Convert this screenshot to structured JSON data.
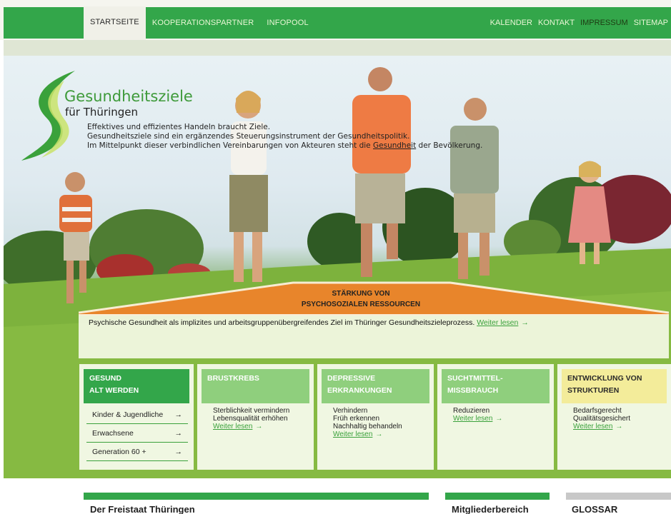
{
  "nav": {
    "left": [
      "STARTSEITE",
      "KOOPERATIONSPARTNER",
      "INFOPOOL"
    ],
    "right": [
      "KALENDER",
      "KONTAKT",
      "IMPRESSUM",
      "SITEMAP"
    ]
  },
  "logo": {
    "title": "Gesundheitsziele",
    "subtitle": "für Thüringen"
  },
  "intro": {
    "line1": "Effektives und effizientes Handeln braucht Ziele.",
    "line2": "Gesundheitsziele sind ein ergänzendes Steuerungsinstrument der Gesundheitspolitik.",
    "line3_a": "Im Mittelpunkt dieser verbindlichen Vereinbarungen von Akteuren steht die",
    "line3_link": "Gesundheit",
    "line3_b": "der Bevölkerung."
  },
  "feature": {
    "title_line1": "STÄRKUNG VON",
    "title_line2": "PSYCHOSOZIALEN RESSOURCEN",
    "text": "Psychische Gesundheit als implizites und arbeitsgruppenübergreifendes Ziel im Thüringer Gesundheitszieleprozess.",
    "more": "Weiter lesen"
  },
  "cards": {
    "c1": {
      "head1": "GESUND",
      "head2": "ALT WERDEN",
      "items": [
        "Kinder & Jugendliche",
        "Erwachsene",
        "Generation 60 +"
      ]
    },
    "c2": {
      "head1": "BRUSTKREBS",
      "lines": [
        "Sterblichkeit vermindern",
        "Lebensqualität erhöhen"
      ],
      "more": "Weiter lesen"
    },
    "c3": {
      "head1": "DEPRESSIVE",
      "head2": "ERKRANKUNGEN",
      "lines": [
        "Verhindern",
        "Früh erkennen",
        "Nachhaltig behandeln"
      ],
      "more": "Weiter lesen"
    },
    "c4": {
      "head1": "SUCHTMITTEL-",
      "head2": "MISSBRAUCH",
      "lines": [
        "Reduzieren"
      ],
      "more": "Weiter lesen"
    },
    "c5": {
      "head1": "ENTWICKLUNG VON",
      "head2": "STRUKTUREN",
      "lines": [
        "Bedarfsgerecht",
        "Qualitätsgesichert"
      ],
      "more": "Weiter lesen"
    }
  },
  "bottom": {
    "col1": "Der Freistaat Thüringen",
    "col2": "Mitgliederbereich",
    "col3": "GLOSSAR"
  },
  "arrow": "→",
  "colors": {
    "green": "#33a64a",
    "orange": "#e8852b",
    "pale_green": "#8fcf7d",
    "yellow": "#f3ec9a"
  }
}
